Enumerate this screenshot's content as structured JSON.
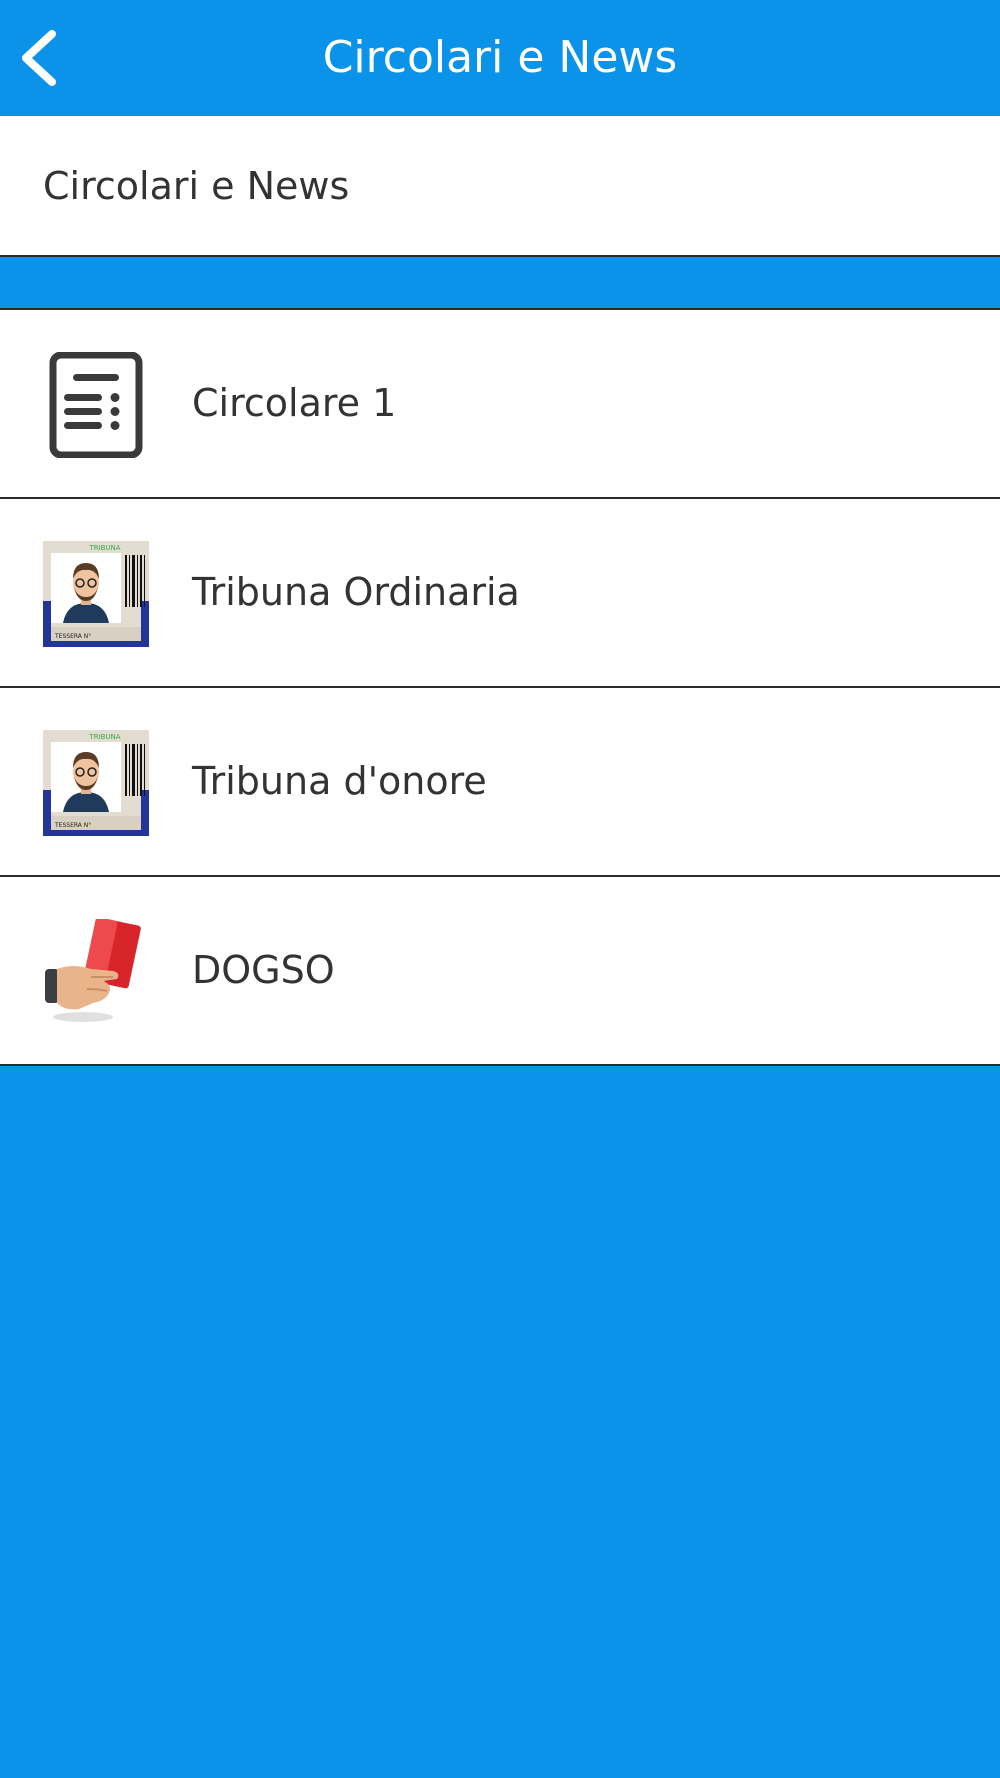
{
  "header": {
    "title": "Circolari e News",
    "back_icon": "chevron-left-icon"
  },
  "section": {
    "title": "Circolari e News"
  },
  "items": [
    {
      "label": "Circolare 1",
      "icon": "document-icon"
    },
    {
      "label": "Tribuna Ordinaria",
      "icon": "id-card-icon",
      "card_header": "TRIBUNA",
      "card_footer": "TESSERA N°"
    },
    {
      "label": "Tribuna d'onore",
      "icon": "id-card-icon",
      "card_header": "TRIBUNA",
      "card_footer": "TESSERA N°"
    },
    {
      "label": "DOGSO",
      "icon": "red-card-icon"
    }
  ],
  "colors": {
    "accent": "#0a93e9",
    "text": "#333333",
    "divider": "#2b2b2b"
  }
}
